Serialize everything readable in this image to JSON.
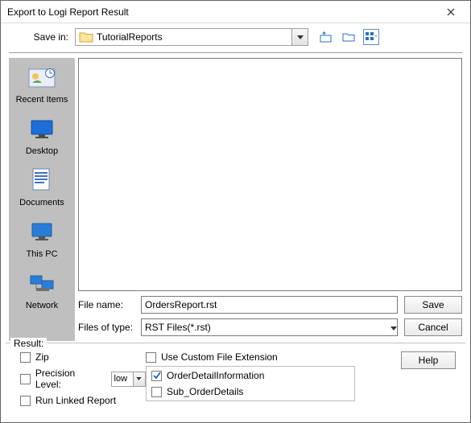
{
  "window": {
    "title": "Export to Logi Report Result"
  },
  "savein": {
    "label": "Save in:",
    "folder": "TutorialReports"
  },
  "shortcuts": [
    {
      "label": "Recent Items"
    },
    {
      "label": "Desktop"
    },
    {
      "label": "Documents"
    },
    {
      "label": "This PC"
    },
    {
      "label": "Network"
    }
  ],
  "filename": {
    "label": "File name:",
    "value": "OrdersReport.rst"
  },
  "filetype": {
    "label": "Files of type:",
    "value": "RST Files(*.rst)"
  },
  "buttons": {
    "save": "Save",
    "cancel": "Cancel",
    "help": "Help"
  },
  "result": {
    "legend": "Result:",
    "zip": "Zip",
    "precision_label": "Precision Level:",
    "precision_value": "low",
    "run_linked": "Run Linked Report",
    "use_custom_ext": "Use Custom File Extension",
    "report_1": "OrderDetailInformation",
    "report_2": "Sub_OrderDetails",
    "checked": {
      "report_1": true
    }
  }
}
